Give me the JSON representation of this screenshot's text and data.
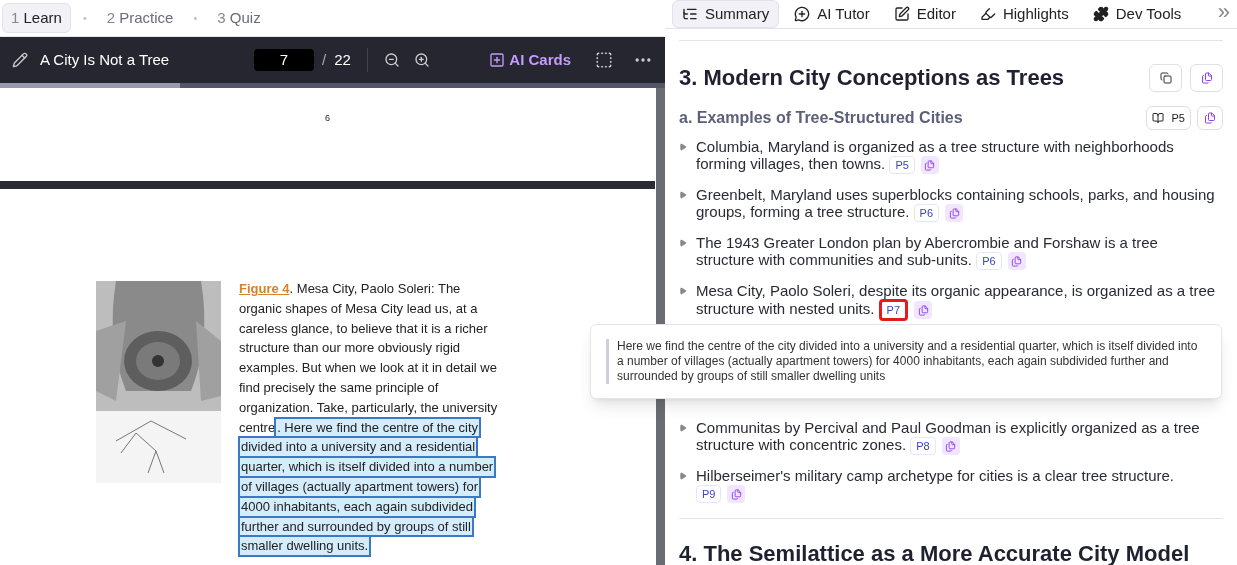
{
  "steps": [
    {
      "number": "1",
      "label": "Learn",
      "selected": true
    },
    {
      "number": "2",
      "label": "Practice",
      "selected": false
    },
    {
      "number": "3",
      "label": "Quiz",
      "selected": false
    }
  ],
  "step_separator": "•",
  "reader": {
    "title": "A City Is Not a Tree",
    "page_input": "7",
    "page_separator": "/",
    "page_total": "22",
    "ai_cards_label": "AI Cards",
    "progress": {
      "level": 0.27
    }
  },
  "pdf": {
    "previous_page_number": "6",
    "figure_label": "Figure 4",
    "caption_lines": [
      [
        {
          "text": ". Mesa City, Paolo Soleri: The",
          "highlighted": false
        }
      ],
      [
        {
          "text": "organic shapes of Mesa City lead us, at a",
          "highlighted": false
        }
      ],
      [
        {
          "text": "careless glance, to believe that it is a richer",
          "highlighted": false
        }
      ],
      [
        {
          "text": "structure than our more obviously rigid",
          "highlighted": false
        }
      ],
      [
        {
          "text": "examples. But when we look at it in detail we",
          "highlighted": false
        }
      ],
      [
        {
          "text": "find precisely the same principle of",
          "highlighted": false
        }
      ],
      [
        {
          "text": "organization. Take, particularly, the university",
          "highlighted": false
        }
      ],
      [
        {
          "text": "centre",
          "highlighted": false
        },
        {
          "text": ". Here we find the centre of the city",
          "highlighted": true
        }
      ],
      [
        {
          "text": "divided into a university and a residential",
          "highlighted": true
        }
      ],
      [
        {
          "text": "quarter, which is itself divided into a number",
          "highlighted": true
        }
      ],
      [
        {
          "text": "of villages (actually apartment towers) for",
          "highlighted": true
        }
      ],
      [
        {
          "text": "4000 inhabitants, each again subdivided",
          "highlighted": true
        }
      ],
      [
        {
          "text": "further and surrounded by groups of still",
          "highlighted": true
        }
      ],
      [
        {
          "text": "smaller dwelling units.",
          "highlighted": true
        }
      ]
    ]
  },
  "side_tabs": [
    {
      "label": "Summary",
      "selected": true,
      "kind": "list"
    },
    {
      "label": "AI Tutor",
      "selected": false,
      "kind": "tutor"
    },
    {
      "label": "Editor",
      "selected": false,
      "kind": "editor"
    },
    {
      "label": "Highlights",
      "selected": false,
      "kind": "highlight"
    },
    {
      "label": "Dev Tools",
      "selected": false,
      "kind": "puzzle"
    }
  ],
  "collapse_label": "»",
  "summary": {
    "section_title": "3. Modern City Conceptions as Trees",
    "subsection": {
      "title": "a. Examples of Tree-Structured Cities",
      "page_ref": "P5"
    },
    "items": [
      {
        "text": "Columbia, Maryland is organized as a tree structure with neighborhoods forming villages, then towns.",
        "page": "P5",
        "selected": false
      },
      {
        "text": "Greenbelt, Maryland uses superblocks containing schools, parks, and housing groups, forming a tree structure.",
        "page": "P6",
        "selected": false
      },
      {
        "text": "The 1943 Greater London plan by Abercrombie and Forshaw is a tree structure with communities and sub-units.",
        "page": "P6",
        "selected": false
      },
      {
        "text": "Mesa City, Paolo Soleri, despite its organic appearance, is organized as a tree structure with nested units.",
        "page": "P7",
        "selected": true
      },
      {
        "kind": "hidden"
      },
      {
        "text": "Communitas by Percival and Paul Goodman is explicitly organized as a tree structure with concentric zones.",
        "page": "P8",
        "selected": false
      },
      {
        "text": "Hilberseimer's military camp archetype for cities is a clear tree structure.",
        "page": "P9",
        "selected": false
      }
    ],
    "next_section_title": "4. The Semilattice as a More Accurate City Model"
  },
  "tooltip": {
    "text": "Here we find the centre of the city divided into a university and a residential quarter, which is itself divided into a number of villages (actually apartment towers) for 4000 inhabitants, each again subdivided further and surrounded by groups of still smaller dwelling units"
  }
}
